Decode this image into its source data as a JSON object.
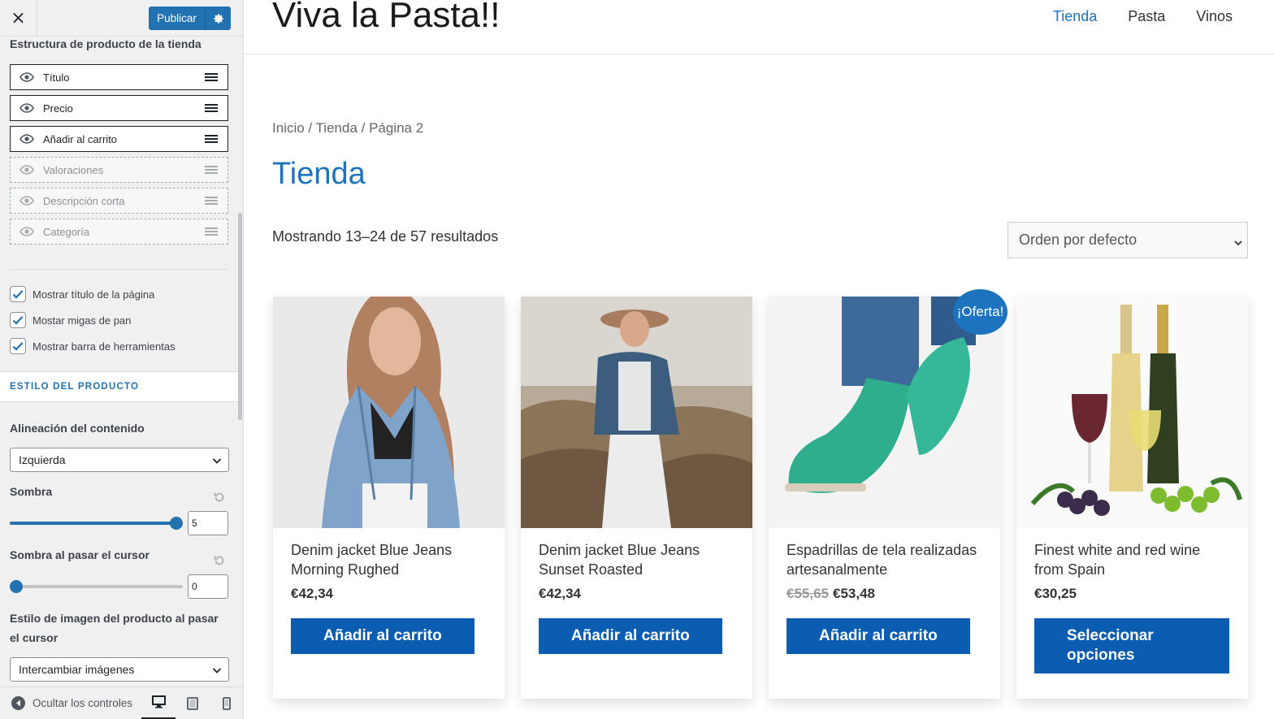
{
  "sidebar": {
    "close_label": "×",
    "publish_label": "Publicar",
    "structure_title": "Estructura de producto de la tienda",
    "structure_items": [
      {
        "label": "Título",
        "visible": true
      },
      {
        "label": "Precio",
        "visible": true
      },
      {
        "label": "Añadir al carrito",
        "visible": true
      },
      {
        "label": "Valoraciones",
        "visible": false
      },
      {
        "label": "Descripción corta",
        "visible": false
      },
      {
        "label": "Categoría",
        "visible": false
      }
    ],
    "checkboxes": [
      {
        "label": "Mostrar título de la página",
        "checked": true
      },
      {
        "label": "Mostar migas de pan",
        "checked": true
      },
      {
        "label": "Mostrar barra de herramientas",
        "checked": true
      }
    ],
    "section_header": "ESTILO DEL PRODUCTO",
    "alignment_label": "Alineación del contenido",
    "alignment_value": "Izquierda",
    "shadow_label": "Sombra",
    "shadow_value": "5",
    "hover_shadow_label": "Sombra al pasar el cursor",
    "hover_shadow_value": "0",
    "image_style_label_1": "Estilo de imagen del producto al pasar",
    "image_style_label_2": "el cursor",
    "image_style_value": "Intercambiar imágenes",
    "hide_controls_label": "Ocultar los controles",
    "accent_color": "#2271b1"
  },
  "site": {
    "title": "Viva la Pasta!!",
    "nav": [
      {
        "label": "Tienda",
        "current": true
      },
      {
        "label": "Pasta",
        "current": false
      },
      {
        "label": "Vinos",
        "current": false
      }
    ],
    "breadcrumb": "Inicio / Tienda / Página 2",
    "page_title": "Tienda",
    "result_count": "Mostrando 13–24 de 57 resultados",
    "orderby": "Orden por defecto",
    "sale_badge": "¡Oferta!",
    "link_color": "#1e73be",
    "button_color": "#0b5db2"
  },
  "products": [
    {
      "name_1": "Denim jacket Blue Jeans",
      "name_2": "Morning Rughed",
      "old_price": "",
      "price": "€42,34",
      "button": "Añadir al carrito"
    },
    {
      "name_1": "Denim jacket Blue Jeans",
      "name_2": "Sunset Roasted",
      "old_price": "",
      "price": "€42,34",
      "button": "Añadir al carrito"
    },
    {
      "name_1": "Espadrillas de tela realizadas",
      "name_2": "artesanalmente",
      "old_price": "€55,65",
      "price": "€53,48",
      "button": "Añadir al carrito"
    },
    {
      "name_1": "Finest white and red wine",
      "name_2": "from Spain",
      "old_price": "",
      "price": "€30,25",
      "button_1": "Seleccionar",
      "button_2": "opciones"
    }
  ]
}
